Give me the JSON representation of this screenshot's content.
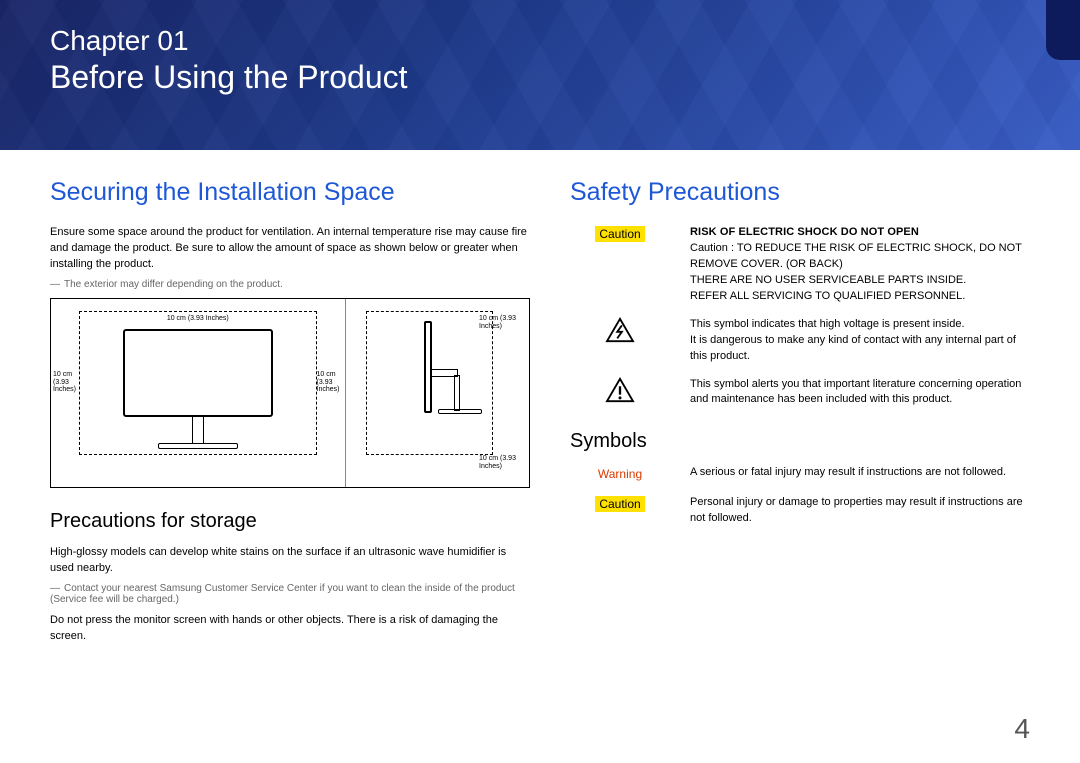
{
  "header": {
    "chapter_label": "Chapter 01",
    "chapter_title": "Before Using the Product"
  },
  "left": {
    "h2": "Securing the Installation Space",
    "p1": "Ensure some space around the product for ventilation. An internal temperature rise may cause fire and damage the product. Be sure to allow the amount of space as shown below or greater when installing the product.",
    "note1": "The exterior may differ depending on the product.",
    "dims": {
      "top": "10 cm (3.93 Inches)",
      "left": "10 cm (3.93 Inches)",
      "right": "10 cm (3.93 Inches)",
      "side_top": "10 cm (3.93 Inches)",
      "side_bottom": "10 cm (3.93 Inches)"
    },
    "h3": "Precautions for storage",
    "p2": "High-glossy models can develop white stains on the surface if an ultrasonic wave humidifier is used nearby.",
    "note2": "Contact your nearest Samsung Customer Service Center if you want to clean the inside of the product (Service fee will be charged.)",
    "p3": "Do not press the monitor screen with hands or other objects. There is a risk of damaging the screen."
  },
  "right": {
    "h2": "Safety Precautions",
    "caution_label": "Caution",
    "risk_heading": "RISK OF ELECTRIC SHOCK DO NOT OPEN",
    "risk_body1": "Caution : TO REDUCE THE RISK OF ELECTRIC SHOCK, DO NOT REMOVE COVER. (OR BACK)",
    "risk_body2": "THERE ARE NO USER SERVICEABLE PARTS INSIDE.",
    "risk_body3": "REFER ALL SERVICING TO QUALIFIED PERSONNEL.",
    "sym1a": "This symbol indicates that high voltage is present inside.",
    "sym1b": "It is dangerous to make any kind of contact with any internal part of this product.",
    "sym2": "This symbol alerts you that important literature concerning operation and maintenance has been included with this product.",
    "h3_symbols": "Symbols",
    "warning_label": "Warning",
    "warning_text": "A serious or fatal injury may result if instructions are not followed.",
    "caution_label2": "Caution",
    "caution_text": "Personal injury or damage to properties may result if instructions are not followed."
  },
  "page_number": "4"
}
